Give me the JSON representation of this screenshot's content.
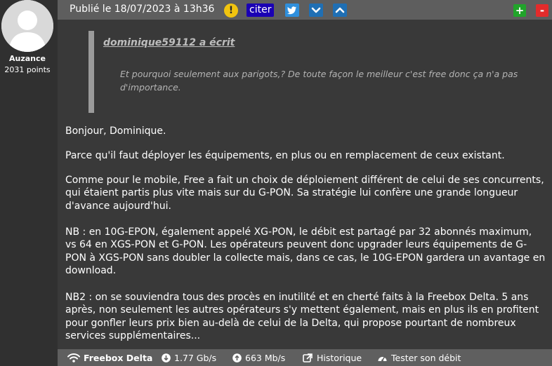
{
  "author": {
    "name": "Auzance",
    "points": "2031 points"
  },
  "header": {
    "published": "Publié le 18/07/2023 à 13h36",
    "quote_button": "citer",
    "plus_label": "+",
    "minus_label": "-",
    "colors": {
      "bar": "#5e5e5e",
      "quote_btn": "#1a00b4",
      "twitter": "#2f8fdc",
      "plus": "#21a42a",
      "minus": "#e32b2b",
      "warn": "#f1c40f"
    }
  },
  "quote": {
    "author": "dominique59112 a écrit",
    "text": "Et pourquoi seulement aux parigots,? De toute façon le meilleur c'est free donc ça n'a pas d'importance."
  },
  "body": {
    "p1": "Bonjour, Dominique.",
    "p2": "Parce qu'il faut déployer les équipements, en plus ou en remplacement de ceux existant.",
    "p3": "Comme pour le mobile, Free a fait un choix de déploiement différent de celui de ses concurrents, qui étaient partis plus vite mais sur du G-PON. Sa stratégie lui confère une grande longueur d'avance aujourd'hui.",
    "p4": "NB : en 10G-EPON, également appelé XG-PON, le débit est partagé par 32 abonnés maximum, vs 64 en XGS-PON et G-PON. Les opérateurs peuvent donc upgrader leurs équipements de G-PON à XGS-PON sans doubler la collecte mais, dans ce cas, le 10G-EPON gardera un avantage en download.",
    "p5": "NB2 : on se souviendra tous des procès en inutilité et en cherté faits à la Freebox Delta. 5 ans après, non seulement les autres opérateurs s'y mettent également, mais en plus ils en profitent pour gonfler leurs prix bien au-delà de celui de la Delta, qui propose pourtant de nombreux services supplémentaires..."
  },
  "footer": {
    "box": "Freebox Delta",
    "download": "1.77 Gb/s",
    "upload": "663 Mb/s",
    "history": "Historique",
    "test": "Tester son débit"
  }
}
